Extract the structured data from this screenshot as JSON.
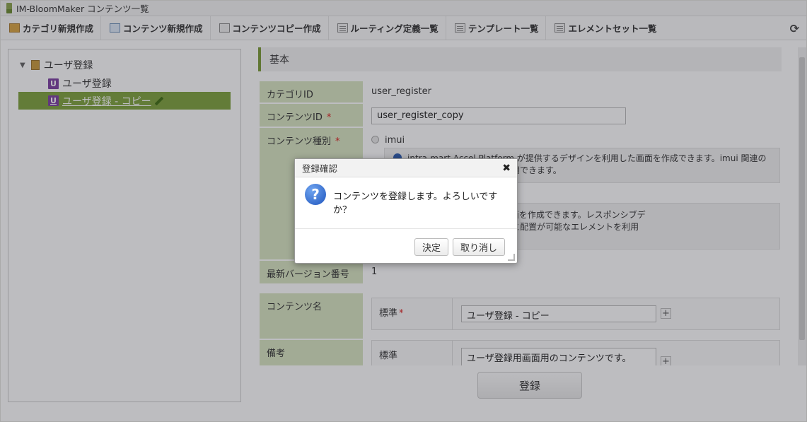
{
  "window": {
    "title": "IM-BloomMaker コンテンツ一覧"
  },
  "toolbar": {
    "items": [
      {
        "label": "カテゴリ新規作成",
        "icon": "folder-new-icon"
      },
      {
        "label": "コンテンツ新規作成",
        "icon": "content-new-icon"
      },
      {
        "label": "コンテンツコピー作成",
        "icon": "copy-icon"
      },
      {
        "label": "ルーティング定義一覧",
        "icon": "list-icon"
      },
      {
        "label": "テンプレート一覧",
        "icon": "list-icon"
      },
      {
        "label": "エレメントセット一覧",
        "icon": "list-icon"
      }
    ],
    "refresh_icon": "refresh-icon"
  },
  "tree": {
    "root": {
      "label": "ユーザ登録",
      "toggle": "▼"
    },
    "children": [
      {
        "badge": "U",
        "label": "ユーザ登録"
      },
      {
        "badge": "U",
        "label": "ユーザ登録 - コピー"
      }
    ]
  },
  "form": {
    "section_title": "基本",
    "category_id": {
      "label": "カテゴリID",
      "value": "user_register"
    },
    "content_id": {
      "label": "コンテンツID",
      "required": "*",
      "value": "user_register_copy"
    },
    "content_type": {
      "label": "コンテンツ種別",
      "required": "*",
      "option1": "imui",
      "option1_desc_line1": "intra-mart Accel Platform が提供するデザインを利用した画面を作成できます。imui 関連の",
      "option1_desc_line2": "eryUI ベースのエレメントを利用できます。",
      "option2_desc_line1": "ムワーク Bulma を利用した画面を作成できます。レスポンシブデ",
      "option2_desc_line2": "用でき、華やかで見やすい配色と配置が可能なエレメントを利用"
    },
    "latest_version": {
      "label": "最新バージョン番号",
      "value": "1"
    },
    "content_name": {
      "label": "コンテンツ名",
      "sub_label": "標準",
      "required": "*",
      "value": "ユーザ登録 - コピー"
    },
    "remarks": {
      "label": "備考",
      "sub_label": "標準",
      "value": "ユーザ登録用画面用のコンテンツです。"
    },
    "submit_label": "登録"
  },
  "dialog": {
    "title": "登録確認",
    "close": "✖",
    "icon": "?",
    "message": "コンテンツを登録します。よろしいですか？",
    "ok_label": "決定",
    "cancel_label": "取り消し"
  }
}
